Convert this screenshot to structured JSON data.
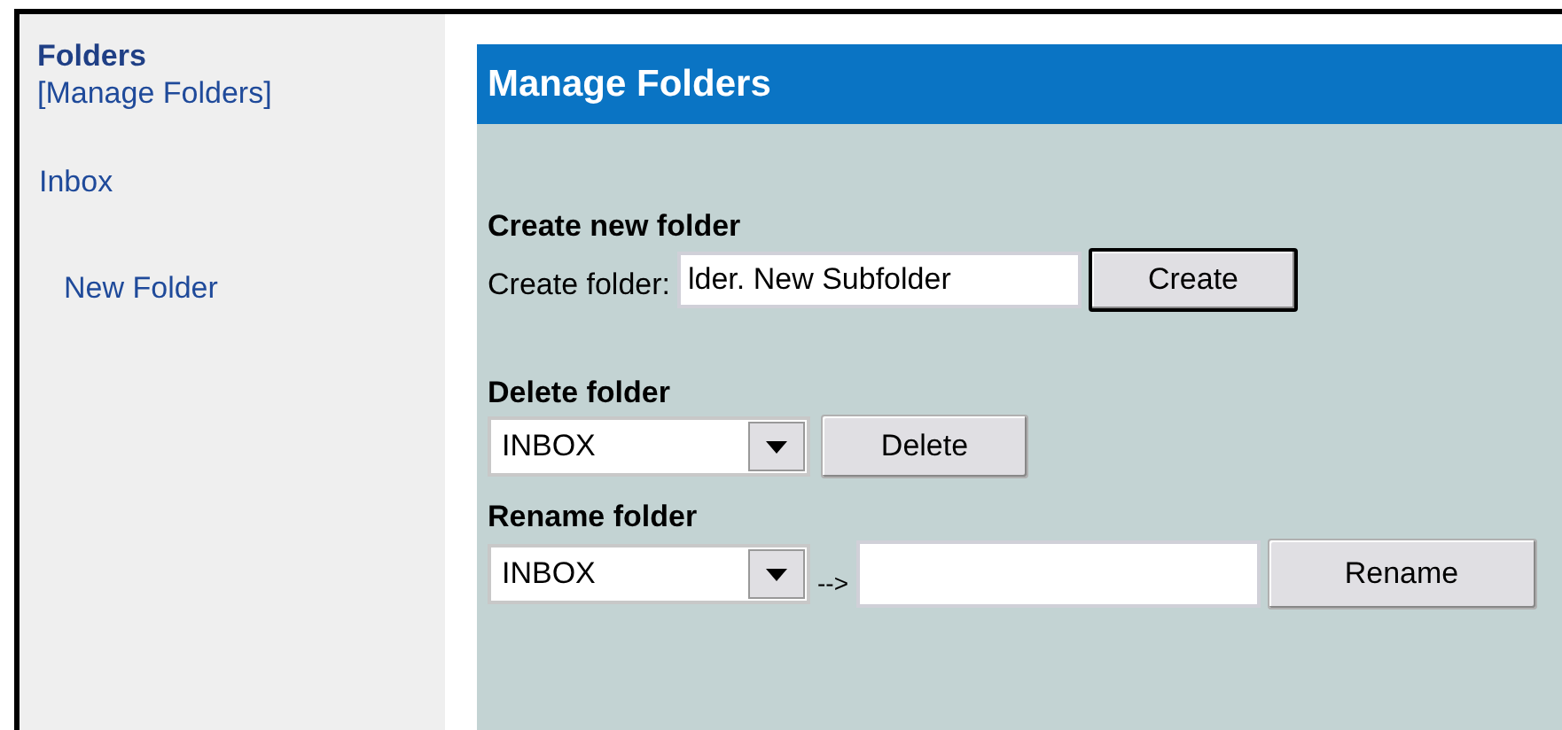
{
  "sidebar": {
    "title": "Folders",
    "manage_link": "[Manage Folders]",
    "folders": [
      {
        "label": "Inbox",
        "children": [
          {
            "label": "New Folder"
          }
        ]
      }
    ]
  },
  "panel": {
    "title": "Manage Folders",
    "create": {
      "heading": "Create new folder",
      "label": "Create folder:",
      "value": "lder. New Subfolder",
      "button": {
        "label": "Create",
        "focused": true
      }
    },
    "delete": {
      "heading": "Delete folder",
      "select": "INBOX",
      "button": {
        "label": "Delete",
        "focused": false
      }
    },
    "rename": {
      "heading": "Rename folder",
      "select": "INBOX",
      "arrow": "-->",
      "button": {
        "label": "Rename",
        "focused": false
      }
    }
  }
}
